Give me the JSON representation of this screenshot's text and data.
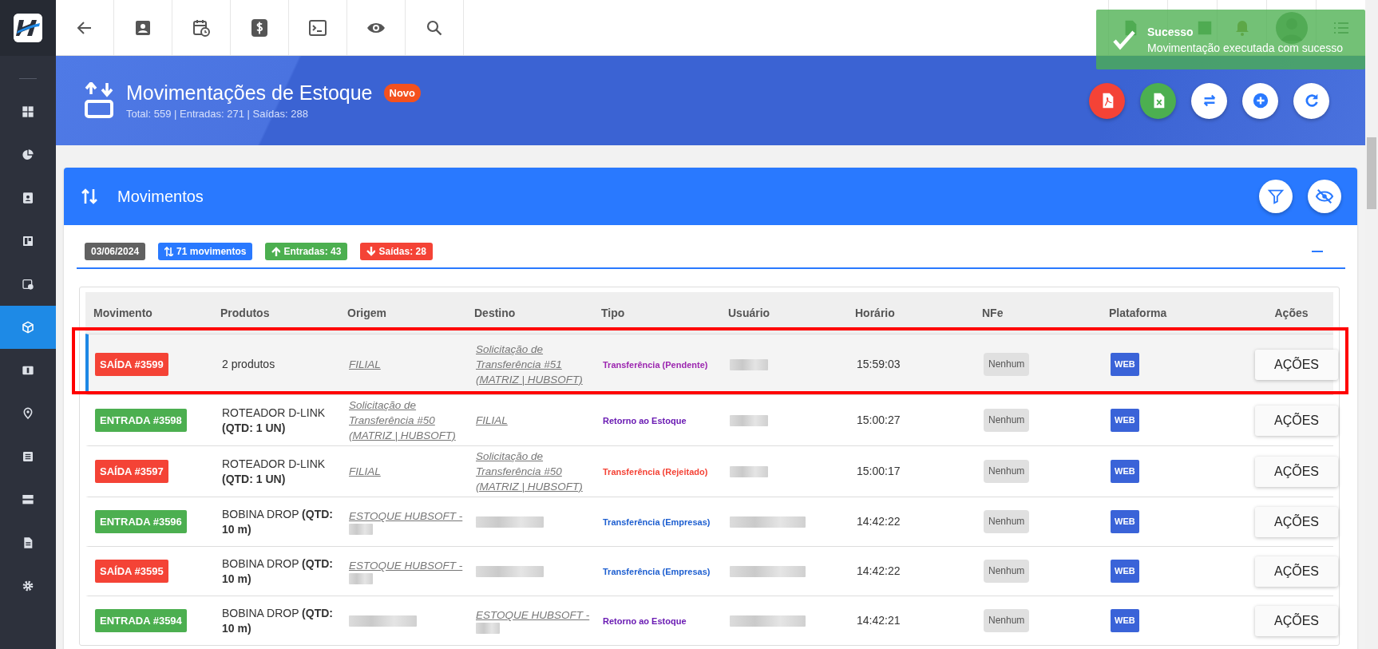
{
  "sidebar": {
    "items": [
      {
        "selected": false
      },
      {
        "selected": false
      },
      {
        "selected": false
      },
      {
        "selected": false
      },
      {
        "selected": false
      },
      {
        "selected": true
      },
      {
        "selected": false
      },
      {
        "selected": false
      },
      {
        "selected": false
      },
      {
        "selected": false
      },
      {
        "selected": false
      },
      {
        "selected": false
      }
    ]
  },
  "toast": {
    "title": "Sucesso",
    "message": "Movimentação executada com sucesso"
  },
  "header": {
    "title": "Movimentações de Estoque",
    "badge": "Novo",
    "summary": "Total: 559 | Entradas: 271 | Saídas: 288"
  },
  "card": {
    "title": "Movimentos",
    "chips": [
      {
        "text": "03/06/2024",
        "kind": "date"
      },
      {
        "text": "71 movimentos",
        "kind": "total"
      },
      {
        "text": "Entradas: 43",
        "kind": "in"
      },
      {
        "text": "Saídas: 28",
        "kind": "out"
      }
    ]
  },
  "table": {
    "columns": [
      "Movimento",
      "Produtos",
      "Origem",
      "Destino",
      "Tipo",
      "Usuário",
      "Horário",
      "NFe",
      "Plataforma",
      "Ações"
    ],
    "rows": [
      {
        "selected": true,
        "highlighted": true,
        "movement": {
          "text": "SAÍDA #3599",
          "kind": "out"
        },
        "products": "2 produtos",
        "origin": {
          "text": "FILIAL"
        },
        "destination": {
          "text": "Solicitação de Transferência #51 (MATRIZ | HUBSOFT)"
        },
        "type": {
          "text": "Transferência (Pendente)",
          "color": "#9c27b0"
        },
        "user": {
          "redacted": true
        },
        "time": "15:59:03",
        "nfe": "Nenhum",
        "platform": "WEB",
        "action": "AÇÕES"
      },
      {
        "selected": false,
        "highlighted": false,
        "movement": {
          "text": "ENTRADA #3598",
          "kind": "in"
        },
        "products": "ROTEADOR D-LINK **(QTD: 1 UN)**",
        "origin": {
          "text": "Solicitação de Transferência #50 (MATRIZ | HUBSOFT)"
        },
        "destination": {
          "text": "FILIAL"
        },
        "type": {
          "text": "Retorno ao Estoque",
          "color": "#6a1bb3"
        },
        "user": {
          "redacted": true
        },
        "time": "15:00:27",
        "nfe": "Nenhum",
        "platform": "WEB",
        "action": "AÇÕES"
      },
      {
        "selected": false,
        "highlighted": false,
        "movement": {
          "text": "SAÍDA #3597",
          "kind": "out"
        },
        "products": "ROTEADOR D-LINK **(QTD: 1 UN)**",
        "origin": {
          "text": "FILIAL"
        },
        "destination": {
          "text": "Solicitação de Transferência #50 (MATRIZ | HUBSOFT)"
        },
        "type": {
          "text": "Transferência (Rejeitado)",
          "color": "#f44336"
        },
        "user": {
          "redacted": true
        },
        "time": "15:00:17",
        "nfe": "Nenhum",
        "platform": "WEB",
        "action": "AÇÕES"
      },
      {
        "selected": false,
        "highlighted": false,
        "movement": {
          "text": "ENTRADA #3596",
          "kind": "in"
        },
        "products": "BOBINA DROP **(QTD: 10 m)**",
        "origin": {
          "text": "ESTOQUE HUBSOFT -",
          "redacted": true
        },
        "destination": {
          "redacted": true
        },
        "type": {
          "text": "Transferência (Empresas)",
          "color": "#1e5fd0"
        },
        "user": {
          "redacted": true
        },
        "time": "14:42:22",
        "nfe": "Nenhum",
        "platform": "WEB",
        "action": "AÇÕES"
      },
      {
        "selected": false,
        "highlighted": false,
        "movement": {
          "text": "SAÍDA #3595",
          "kind": "out"
        },
        "products": "BOBINA DROP **(QTD: 10 m)**",
        "origin": {
          "text": "ESTOQUE HUBSOFT -",
          "redacted": true
        },
        "destination": {
          "redacted": true
        },
        "type": {
          "text": "Transferência (Empresas)",
          "color": "#1e5fd0"
        },
        "user": {
          "redacted": true
        },
        "time": "14:42:22",
        "nfe": "Nenhum",
        "platform": "WEB",
        "action": "AÇÕES"
      },
      {
        "selected": false,
        "highlighted": false,
        "movement": {
          "text": "ENTRADA #3594",
          "kind": "in"
        },
        "products": "BOBINA DROP **(QTD: 10 m)**",
        "origin": {
          "redacted": true
        },
        "destination": {
          "text": "ESTOQUE HUBSOFT -",
          "redacted": true
        },
        "type": {
          "text": "Retorno ao Estoque",
          "color": "#6a1bb3"
        },
        "user": {
          "redacted": true
        },
        "time": "14:42:21",
        "nfe": "Nenhum",
        "platform": "WEB",
        "action": "AÇÕES"
      }
    ]
  }
}
